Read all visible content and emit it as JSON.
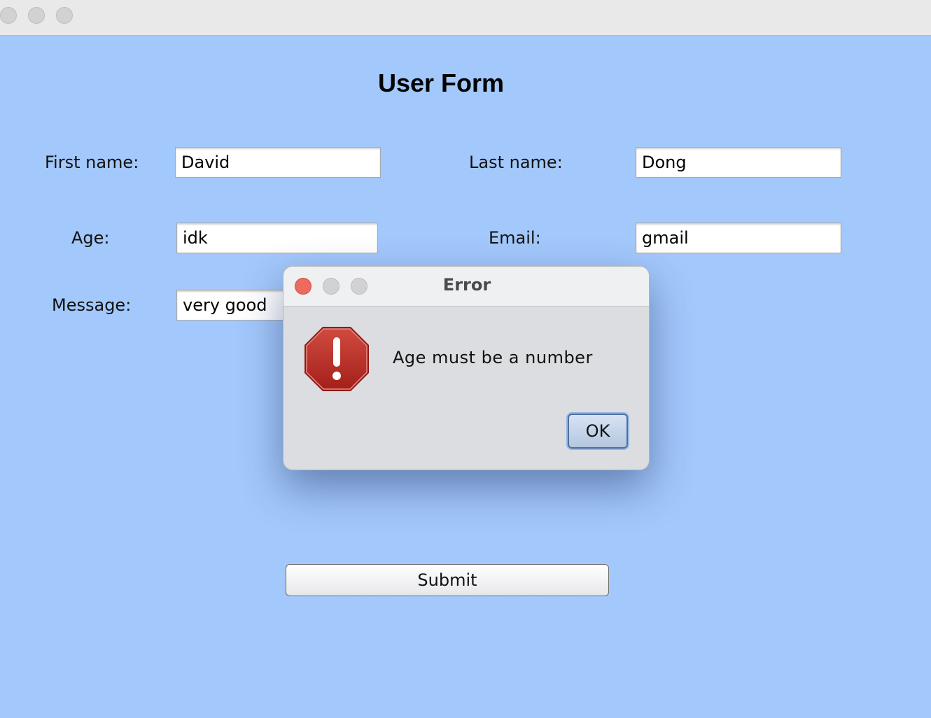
{
  "window": {
    "title": ""
  },
  "form": {
    "title": "User Form",
    "first_name_label": "First name:",
    "first_name_value": "David",
    "last_name_label": "Last name:",
    "last_name_value": "Dong",
    "age_label": "Age:",
    "age_value": "idk",
    "email_label": "Email:",
    "email_value": "gmail",
    "message_label": "Message:",
    "message_value": "very good",
    "submit_label": "Submit"
  },
  "dialog": {
    "title": "Error",
    "message": "Age must be a number",
    "ok_label": "OK",
    "icon": "error-stop-icon"
  },
  "colors": {
    "background": "#a3c8fb",
    "dialog_close": "#ed6a5e",
    "error_icon": "#b32a22"
  }
}
